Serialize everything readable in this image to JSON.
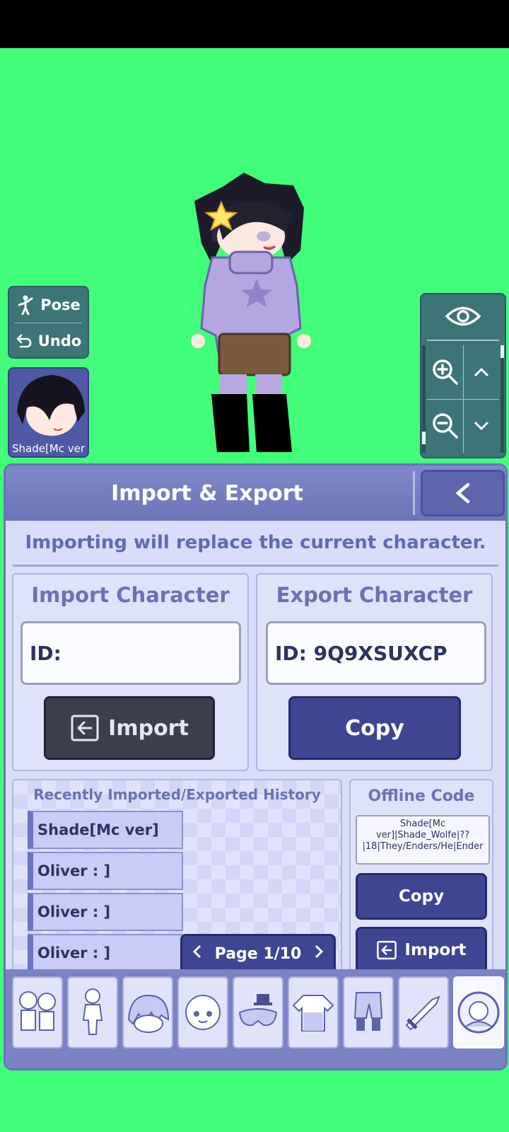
{
  "left_panel": {
    "pose_label": "Pose",
    "undo_label": "Undo",
    "character_name": "Shade[Mc ver"
  },
  "panel": {
    "title": "Import & Export",
    "back_symbol": "<",
    "warning": "Importing will replace the current character."
  },
  "import": {
    "title": "Import Character",
    "id_value": "ID:",
    "button_label": "Import"
  },
  "export": {
    "title": "Export Character",
    "id_value": "ID: 9Q9XSUXCP",
    "button_label": "Copy"
  },
  "history": {
    "title": "Recently Imported/Exported History",
    "items": [
      "Shade[Mc ver]",
      "Oliver : ]",
      "Oliver : ]",
      "Oliver : ]"
    ],
    "page_label": "Page 1/10"
  },
  "offline": {
    "title": "Offline Code",
    "code_text": "Shade[Mc ver]|Shade_Wolfe|??|18|They/Enders/He|Ender",
    "copy_label": "Copy",
    "import_label": "Import"
  },
  "tabs": [
    "presets",
    "body",
    "hair",
    "face",
    "accessories",
    "top",
    "bottom",
    "props",
    "profile"
  ],
  "colors": {
    "background": "#41fd7a",
    "panel": "#d9dcfa",
    "accent": "#3e4592",
    "title": "#6a72b2"
  }
}
